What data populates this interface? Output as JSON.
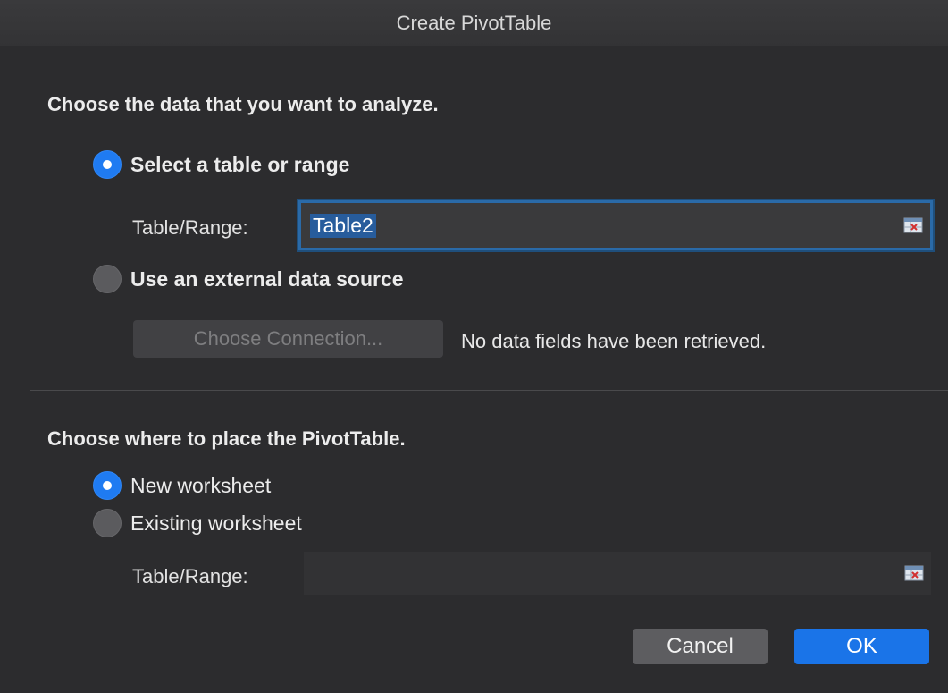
{
  "dialog": {
    "title": "Create PivotTable"
  },
  "source_section": {
    "heading": "Choose the data that you want to analyze.",
    "option_table_range": {
      "label": "Select a table or range",
      "selected": true
    },
    "table_range_label": "Table/Range:",
    "table_range_value": "Table2",
    "option_external": {
      "label": "Use an external data source",
      "selected": false
    },
    "choose_connection_label": "Choose Connection...",
    "connection_status": "No data fields have been retrieved."
  },
  "placement_section": {
    "heading": "Choose where to place the PivotTable.",
    "option_new_worksheet": {
      "label": "New worksheet",
      "selected": true
    },
    "option_existing_worksheet": {
      "label": "Existing worksheet",
      "selected": false
    },
    "table_range_label": "Table/Range:",
    "table_range_value": ""
  },
  "buttons": {
    "cancel_label": "Cancel",
    "ok_label": "OK"
  },
  "icons": {
    "range_picker": "collapse-dialog-icon"
  },
  "colors": {
    "accent": "#1a74e8",
    "background": "#2c2c2e",
    "focus_ring": "#2a6aa8"
  }
}
